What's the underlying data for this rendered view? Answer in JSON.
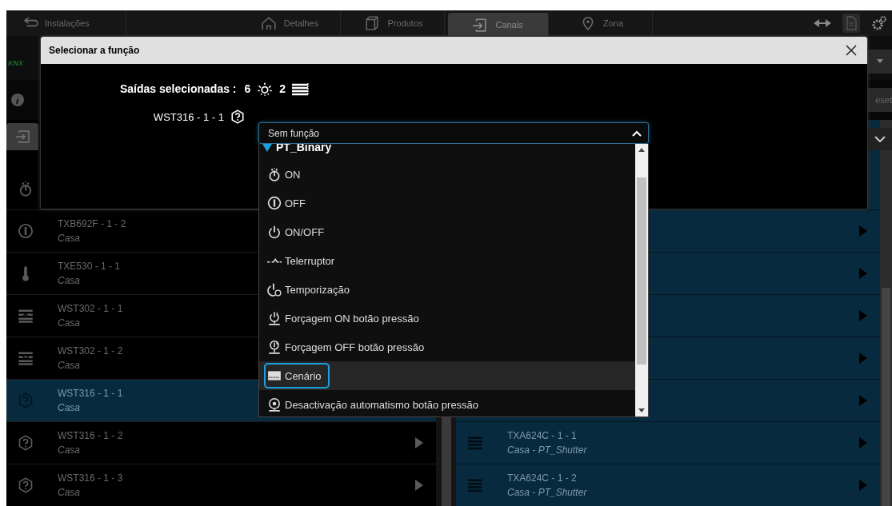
{
  "nav": {
    "back_label": "Instalações",
    "tabs": [
      {
        "label": "Detalhes",
        "kind": "house",
        "selected": false
      },
      {
        "label": "Produtos",
        "kind": "box",
        "selected": false
      },
      {
        "label": "Canais",
        "kind": "channels",
        "selected": true
      },
      {
        "label": "Zona",
        "kind": "pin",
        "selected": false
      }
    ]
  },
  "toolbar": {
    "logo": "KNX",
    "reset_button": "eset"
  },
  "left_list": {
    "rows": [
      {
        "kind": "on",
        "selected": false
      },
      {
        "kind": "off",
        "title": "TXB692F - 1 - 2",
        "subtitle": "Casa",
        "selected": false
      },
      {
        "kind": "thermometer",
        "title": "TXE530 - 1 - 1",
        "subtitle": "Casa",
        "selected": false
      },
      {
        "kind": "shutter-up",
        "title": "WST302 - 1 - 1",
        "subtitle": "Casa",
        "selected": false
      },
      {
        "kind": "shutter-down",
        "title": "WST302 - 1 - 2",
        "subtitle": "Casa",
        "selected": false
      },
      {
        "kind": "unknown",
        "title": "WST316 - 1 - 1",
        "subtitle": "Casa",
        "selected": true
      },
      {
        "kind": "unknown",
        "title": "WST316 - 1 - 2",
        "subtitle": "Casa",
        "selected": false
      },
      {
        "kind": "unknown",
        "title": "WST316 - 1 - 3",
        "subtitle": "Casa",
        "selected": false
      }
    ]
  },
  "right_list": {
    "rows": [
      {
        "kind": "blank"
      },
      {
        "kind": "blank"
      },
      {
        "kind": "blank"
      },
      {
        "kind": "blank"
      },
      {
        "kind": "blank"
      },
      {
        "kind": "blank"
      },
      {
        "kind": "shutter",
        "title": "TXA624C - 1 - 1",
        "subtitle": "Casa - PT_Shutter"
      },
      {
        "kind": "shutter",
        "title": "TXA624C - 1 - 2",
        "subtitle": "Casa - PT_Shutter"
      }
    ]
  },
  "dialog": {
    "title": "Selecionar a função",
    "outputs_label": "Saídas selecionadas :",
    "light_count": "6",
    "shutter_count": "2",
    "channel_label": "WST316 - 1 - 1",
    "select": {
      "value": "Sem função",
      "expanded": true,
      "group": "PT_Binary",
      "options": [
        {
          "kind": "on",
          "label": "ON",
          "selected": false
        },
        {
          "kind": "off",
          "label": "OFF",
          "selected": false
        },
        {
          "kind": "onoff",
          "label": "ON/OFF",
          "selected": false
        },
        {
          "kind": "toggle",
          "label": "Telerruptor",
          "selected": false
        },
        {
          "kind": "timer",
          "label": "Temporização",
          "selected": false
        },
        {
          "kind": "force-on",
          "label": "Forçagem ON botão pressão",
          "selected": false
        },
        {
          "kind": "force-off",
          "label": "Forçagem OFF botão pressão",
          "selected": false
        },
        {
          "kind": "scene",
          "label": "Cenário",
          "selected": true
        },
        {
          "kind": "auto-off",
          "label": "Desactivação automatismo botão pressão",
          "selected": false
        }
      ]
    }
  }
}
